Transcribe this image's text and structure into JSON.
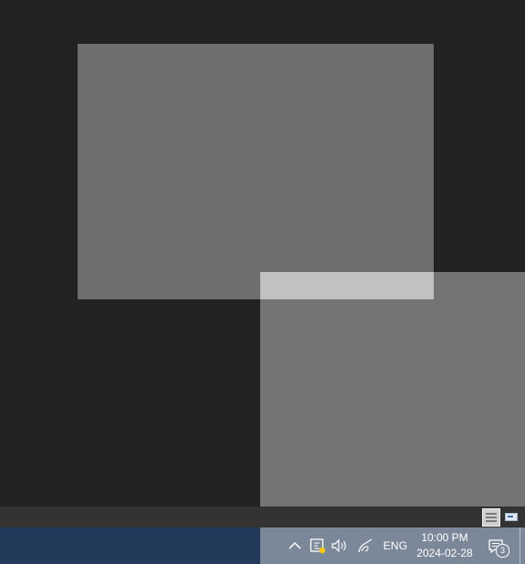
{
  "desktop": {
    "background_color": "#222222"
  },
  "status_strip": {
    "view_buttons": [
      {
        "name": "list-view",
        "selected": true
      },
      {
        "name": "thumbnail-view",
        "selected": false
      }
    ]
  },
  "taskbar": {
    "background_color": "#243a5b",
    "tray": {
      "icons": [
        "chevron-up-icon",
        "windows-security-icon",
        "volume-icon",
        "pen-workspace-icon"
      ],
      "language": "ENG",
      "time": "10:00 PM",
      "date": "2024-02-28",
      "notification_count": "3"
    }
  }
}
